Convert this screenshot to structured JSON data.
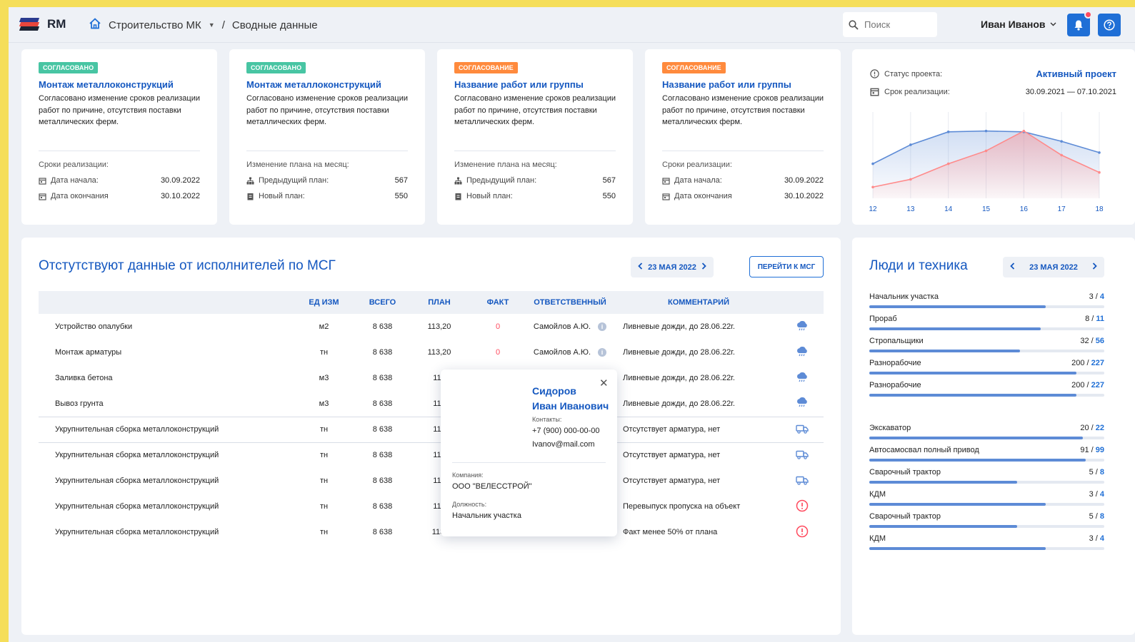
{
  "app": {
    "logo_text": "RM",
    "accent": "#1f6fd6"
  },
  "breadcrumb": {
    "project": "Строительство МК",
    "page": "Сводные данные",
    "separator": "/"
  },
  "search": {
    "placeholder": "Поиск"
  },
  "user": {
    "name": "Иван Иванов"
  },
  "notes": [
    {
      "badge": "СОГЛАСОВАНО",
      "badge_type": "ok",
      "title": "Монтаж металлоконструкций",
      "desc": "Согласовано изменение сроков реализации работ по причине, отсутствия поставки металлических ферм.",
      "sub": "Сроки реализации:",
      "rows": [
        {
          "icon": "calendar-icon",
          "label": "Дата начала:",
          "value": "30.09.2022"
        },
        {
          "icon": "calendar-icon",
          "label": "Дата окончания",
          "value": "30.10.2022"
        }
      ]
    },
    {
      "badge": "СОГЛАСОВАНО",
      "badge_type": "ok",
      "title": "Монтаж металлоконструкций",
      "desc": "Согласовано изменение сроков реализации работ по причине, отсутствия поставки металлических ферм.",
      "sub": "Изменение плана на месяц:",
      "rows": [
        {
          "icon": "hierarchy-icon",
          "label": "Предыдущий план:",
          "value": "567"
        },
        {
          "icon": "clipboard-icon",
          "label": "Новый план:",
          "value": "550"
        }
      ]
    },
    {
      "badge": "СОГЛАСОВАНИЕ",
      "badge_type": "pending",
      "title": "Название работ или группы",
      "desc": "Согласовано изменение сроков реализации работ по причине, отсутствия поставки металлических ферм.",
      "sub": "Изменение плана на месяц:",
      "rows": [
        {
          "icon": "hierarchy-icon",
          "label": "Предыдущий план:",
          "value": "567"
        },
        {
          "icon": "clipboard-icon",
          "label": "Новый план:",
          "value": "550"
        }
      ]
    },
    {
      "badge": "СОГЛАСОВАНИЕ",
      "badge_type": "pending",
      "title": "Название работ или группы",
      "desc": "Согласовано изменение сроков реализации работ по причине, отсутствия поставки металлических ферм.",
      "sub": "Сроки реализации:",
      "rows": [
        {
          "icon": "calendar-icon",
          "label": "Дата начала:",
          "value": "30.09.2022"
        },
        {
          "icon": "calendar-icon",
          "label": "Дата окончания",
          "value": "30.10.2022"
        }
      ]
    }
  ],
  "project_status": {
    "status_label": "Статус проекта:",
    "status_value": "Активный проект",
    "period_label": "Срок реализации:",
    "period_value": "30.09.2021 — 07.10.2021"
  },
  "chart_data": {
    "type": "area",
    "x": [
      12,
      13,
      14,
      15,
      16,
      17,
      18
    ],
    "series": [
      {
        "values": [
          40,
          62,
          77,
          78,
          77,
          66,
          53
        ],
        "color": "#5d8bd6"
      },
      {
        "values": [
          13,
          22,
          40,
          55,
          78,
          50,
          30
        ],
        "color": "#ff8a8a"
      }
    ],
    "ylim": [
      0,
      100
    ],
    "grid": "vertical"
  },
  "missing": {
    "title": "Отстутствуют данные от исполнителей по МСГ",
    "date": "23 МАЯ 2022",
    "goto_button": "ПЕРЕЙТИ К МСГ",
    "columns": [
      "",
      "ЕД ИЗМ",
      "ВСЕГО",
      "ПЛАН",
      "ФАКТ",
      "ОТВЕТСТВЕННЫЙ",
      "КОММЕНТАРИЙ",
      ""
    ],
    "rows": [
      {
        "name": "Устройство опалубки",
        "unit": "м2",
        "total": "8 638",
        "plan": "113,20",
        "fact": "0",
        "resp": "Самойлов А.Ю.",
        "comment": "Ливневые дожди, до 28.06.22г.",
        "icon": "rain-cloud-icon"
      },
      {
        "name": "Монтаж арматуры",
        "unit": "тн",
        "total": "8 638",
        "plan": "113,20",
        "fact": "0",
        "resp": "Самойлов А.Ю.",
        "comment": "Ливневые дожди, до 28.06.22г.",
        "icon": "rain-cloud-icon"
      },
      {
        "name": "Заливка бетона",
        "unit": "м3",
        "total": "8 638",
        "plan": "113",
        "fact": "",
        "resp": "",
        "comment": "Ливневые дожди, до 28.06.22г.",
        "icon": "rain-cloud-icon"
      },
      {
        "name": "Вывоз грунта",
        "unit": "м3",
        "total": "8 638",
        "plan": "113",
        "fact": "",
        "resp": "",
        "comment": "Ливневые дожди, до 28.06.22г.",
        "icon": "rain-cloud-icon"
      },
      {
        "name": "Укрупнительная сборка металлоконструкций",
        "unit": "тн",
        "total": "8 638",
        "plan": "113",
        "fact": "",
        "resp": "",
        "comment": "Отсутствует арматура, нет",
        "icon": "truck-icon"
      },
      {
        "name": "Укрупнительная сборка металлоконструкций",
        "unit": "тн",
        "total": "8 638",
        "plan": "113",
        "fact": "",
        "resp": "",
        "comment": "Отсутствует арматура, нет",
        "icon": "truck-icon"
      },
      {
        "name": "Укрупнительная сборка металлоконструкций",
        "unit": "тн",
        "total": "8 638",
        "plan": "113",
        "fact": "",
        "resp": "",
        "comment": "Отсутствует арматура, нет",
        "icon": "truck-icon"
      },
      {
        "name": "Укрупнительная сборка металлоконструкций",
        "unit": "тн",
        "total": "8 638",
        "plan": "113",
        "fact": "",
        "resp": "",
        "comment": "Перевыпуск пропуска на объект",
        "icon": "alert-icon"
      },
      {
        "name": "Укрупнительная сборка металлоконструкций",
        "unit": "тн",
        "total": "8 638",
        "plan": "113,",
        "fact": "",
        "resp": "",
        "comment": "Факт менее 50% от плана",
        "icon": "alert-icon"
      }
    ]
  },
  "contact_popup": {
    "name_line1": "Сидоров",
    "name_line2": "Иван Иванович",
    "contacts_label": "Контакты:",
    "phone": "+7 (900) 000-00-00",
    "email": "Ivanov@mail.com",
    "company_label": "Компания:",
    "company": "ООО \"ВЕЛЕССТРОЙ\"",
    "position_label": "Должность:",
    "position": "Начальник участка"
  },
  "people": {
    "title": "Люди и техника",
    "date": "23 МАЯ 2022",
    "staff": [
      {
        "label": "Начальник участка",
        "num": "3",
        "total": "4",
        "progress": 0.75
      },
      {
        "label": "Прораб",
        "num": "8",
        "total": "11",
        "progress": 0.73
      },
      {
        "label": "Стропальщики",
        "num": "32",
        "total": "56",
        "progress": 0.64
      },
      {
        "label": "Разнорабочие",
        "num": "200",
        "total": "227",
        "progress": 0.88
      },
      {
        "label": "Разнорабочие",
        "num": "200",
        "total": "227",
        "progress": 0.88
      }
    ],
    "equipment": [
      {
        "label": "Экскаватор",
        "num": "20",
        "total": "22",
        "progress": 0.91
      },
      {
        "label": "Автосамосвал полный привод",
        "num": "91",
        "total": "99",
        "progress": 0.92
      },
      {
        "label": "Сварочный трактор",
        "num": "5",
        "total": "8",
        "progress": 0.63
      },
      {
        "label": "КДМ",
        "num": "3",
        "total": "4",
        "progress": 0.75
      },
      {
        "label": "Сварочный трактор",
        "num": "5",
        "total": "8",
        "progress": 0.63
      },
      {
        "label": "КДМ",
        "num": "3",
        "total": "4",
        "progress": 0.75
      }
    ]
  }
}
